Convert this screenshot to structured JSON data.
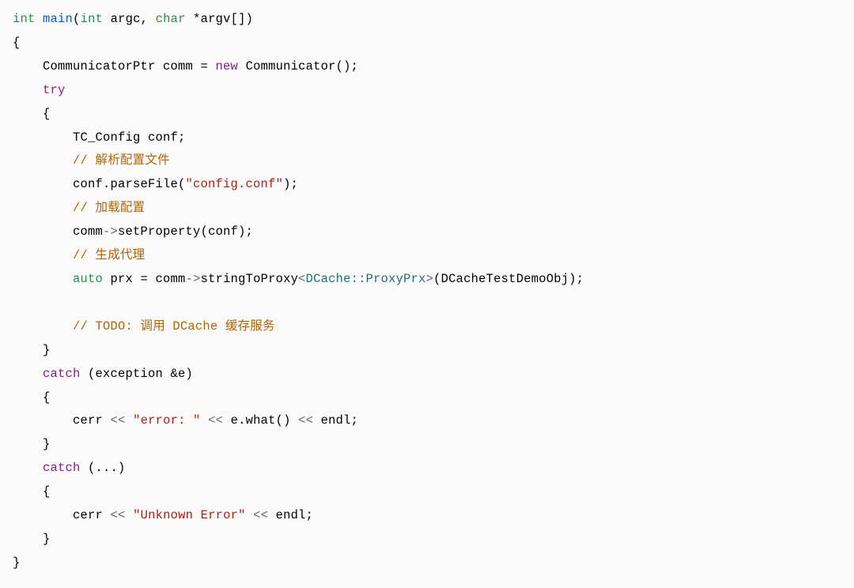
{
  "code": {
    "sig_int": "int",
    "sig_main": "main",
    "sig_open": "(",
    "sig_argc_t": "int",
    "sig_argc": " argc, ",
    "sig_argv_t": "char",
    "sig_argv": " *argv[])",
    "brace_open1": "{",
    "l1a": "    CommunicatorPtr comm = ",
    "l1_new": "new",
    "l1b": " Communicator();",
    "l2_try": "    try",
    "brace_open2": "    {",
    "l3": "        TC_Config conf;",
    "c1": "        // 解析配置文件",
    "l4a": "        conf.parseFile(",
    "l4s": "\"config.conf\"",
    "l4b": ");",
    "c2": "        // 加载配置",
    "l5a": "        comm",
    "l5op": "->",
    "l5b": "setProperty(conf);",
    "c3": "        // 生成代理",
    "l6_auto": "        auto",
    "l6a": " prx = comm",
    "l6op": "->",
    "l6b": "stringToProxy",
    "l6lt": "<",
    "l6t": "DCache::ProxyPrx",
    "l6gt": ">",
    "l6c": "(DCacheTestDemoObj);",
    "c4": "        // TODO: 调用 DCache 缓存服务",
    "brace_close2": "    }",
    "l7_catch": "    catch",
    "l7a": " (exception &e)",
    "brace_open3": "    {",
    "l8a": "        cerr ",
    "l8op1": "<<",
    "l8sp1": " ",
    "l8s": "\"error: \"",
    "l8sp2": " ",
    "l8op2": "<<",
    "l8b": " e.what() ",
    "l8op3": "<<",
    "l8c": " endl;",
    "brace_close3": "    }",
    "l9_catch": "    catch",
    "l9a": " (...)",
    "brace_open4": "    {",
    "l10a": "        cerr ",
    "l10op1": "<<",
    "l10sp1": " ",
    "l10s": "\"Unknown Error\"",
    "l10sp2": " ",
    "l10op2": "<<",
    "l10b": " endl;",
    "brace_close4": "    }",
    "brace_close1": "}"
  }
}
